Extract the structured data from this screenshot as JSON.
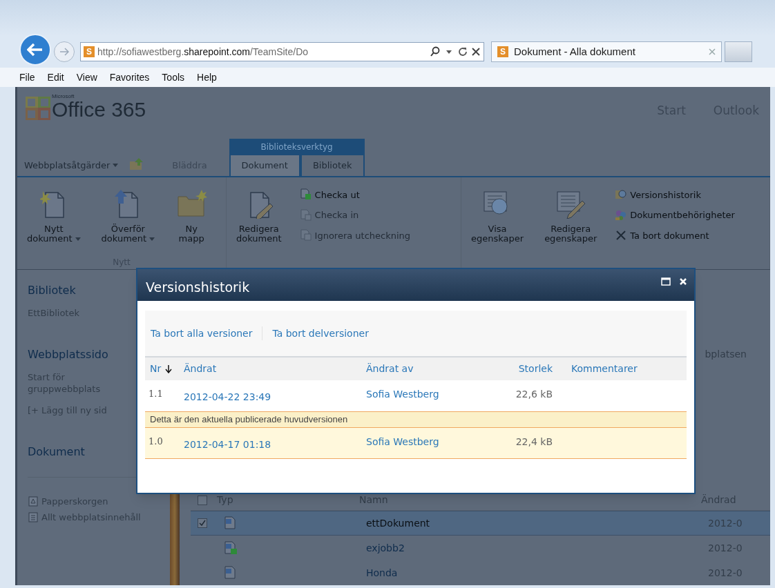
{
  "browser": {
    "site_icon": "S",
    "address": "http://sofiawestberg.**sharepoint.com**/TeamSite/Do",
    "tab_icon": "S",
    "tab_title": "Dokument - Alla dokument"
  },
  "menu": [
    "File",
    "Edit",
    "View",
    "Favorites",
    "Tools",
    "Help"
  ],
  "header": {
    "brand_small": "Microsoft",
    "product": "Office 365",
    "links": [
      "Start",
      "Outlook"
    ]
  },
  "ribbon": {
    "context_label": "Biblioteksverktyg",
    "site_actions": "Webbplatsåtgärder",
    "tabs": [
      {
        "label": "Bläddra",
        "selected": false
      },
      {
        "label": "Dokument",
        "selected": true
      },
      {
        "label": "Bibliotek",
        "selected": false
      }
    ],
    "groups": [
      {
        "label": "Nytt",
        "items": [
          {
            "kind": "large",
            "lines": [
              "Nytt",
              "dokument"
            ],
            "dropdown": true
          },
          {
            "kind": "large",
            "lines": [
              "Överför",
              "dokument"
            ],
            "dropdown": true
          },
          {
            "kind": "large",
            "lines": [
              "Ny",
              "mapp"
            ],
            "dropdown": false
          }
        ]
      },
      {
        "items": [
          {
            "kind": "large",
            "lines": [
              "Redigera",
              "dokument"
            ],
            "dropdown": false
          },
          {
            "kind": "stack",
            "entries": [
              {
                "label": "Checka ut",
                "disabled": false
              },
              {
                "label": "Checka in",
                "disabled": true
              },
              {
                "label": "Ignorera utcheckning",
                "disabled": true
              }
            ]
          }
        ]
      },
      {
        "items": [
          {
            "kind": "large",
            "lines": [
              "Visa",
              "egenskaper"
            ],
            "dropdown": false
          },
          {
            "kind": "large",
            "lines": [
              "Redigera",
              "egenskaper"
            ],
            "dropdown": false
          },
          {
            "kind": "stack",
            "entries": [
              {
                "label": "Versionshistorik",
                "disabled": false
              },
              {
                "label": "Dokumentbehörigheter",
                "disabled": false
              },
              {
                "label": "Ta bort dokument",
                "disabled": false
              }
            ]
          }
        ]
      }
    ]
  },
  "nav": {
    "sections": [
      {
        "heading": "Bibliotek",
        "items": [
          "EttBibliotek"
        ]
      },
      {
        "heading": "Webbplatssido",
        "items": [
          "Start för gruppwebbplats",
          "[+ Lägg till ny sid"
        ]
      },
      {
        "heading": "Dokument"
      }
    ],
    "bottom": [
      "Papperskorgen",
      "Allt webbplatsinnehåll"
    ]
  },
  "side_text": "bplatsen",
  "list": {
    "select_all_checked": false,
    "columns": [
      "Typ",
      "Namn",
      "Ändrad"
    ],
    "rows": [
      {
        "name": "ettDokument",
        "modified": "2012-0",
        "selected": true,
        "checked_out": false
      },
      {
        "name": "exjobb2",
        "modified": "2012-0",
        "selected": false,
        "checked_out": true
      },
      {
        "name": "Honda",
        "modified": "2012-0",
        "selected": false,
        "checked_out": false
      }
    ]
  },
  "dialog": {
    "title": "Versionshistorik",
    "actions": [
      "Ta bort alla versioner",
      "Ta bort delversioner"
    ],
    "columns": [
      {
        "label": "Nr",
        "sorted": true
      },
      {
        "label": "Ändrat",
        "sorted": false
      },
      {
        "label": "Ändrat av",
        "sorted": false
      },
      {
        "label": "Storlek",
        "sorted": false
      },
      {
        "label": "Kommentarer",
        "sorted": false
      }
    ],
    "current_note": "Detta är den aktuella publicerade huvudversionen",
    "versions": [
      {
        "number": "1.1",
        "modified": "2012-04-22 23:49",
        "author": "Sofia Westberg",
        "size": "22,6 kB",
        "current": false
      },
      {
        "number": "1.0",
        "modified": "2012-04-17 01:18",
        "author": "Sofia Westberg",
        "size": "22,4 kB",
        "current": true
      }
    ]
  }
}
